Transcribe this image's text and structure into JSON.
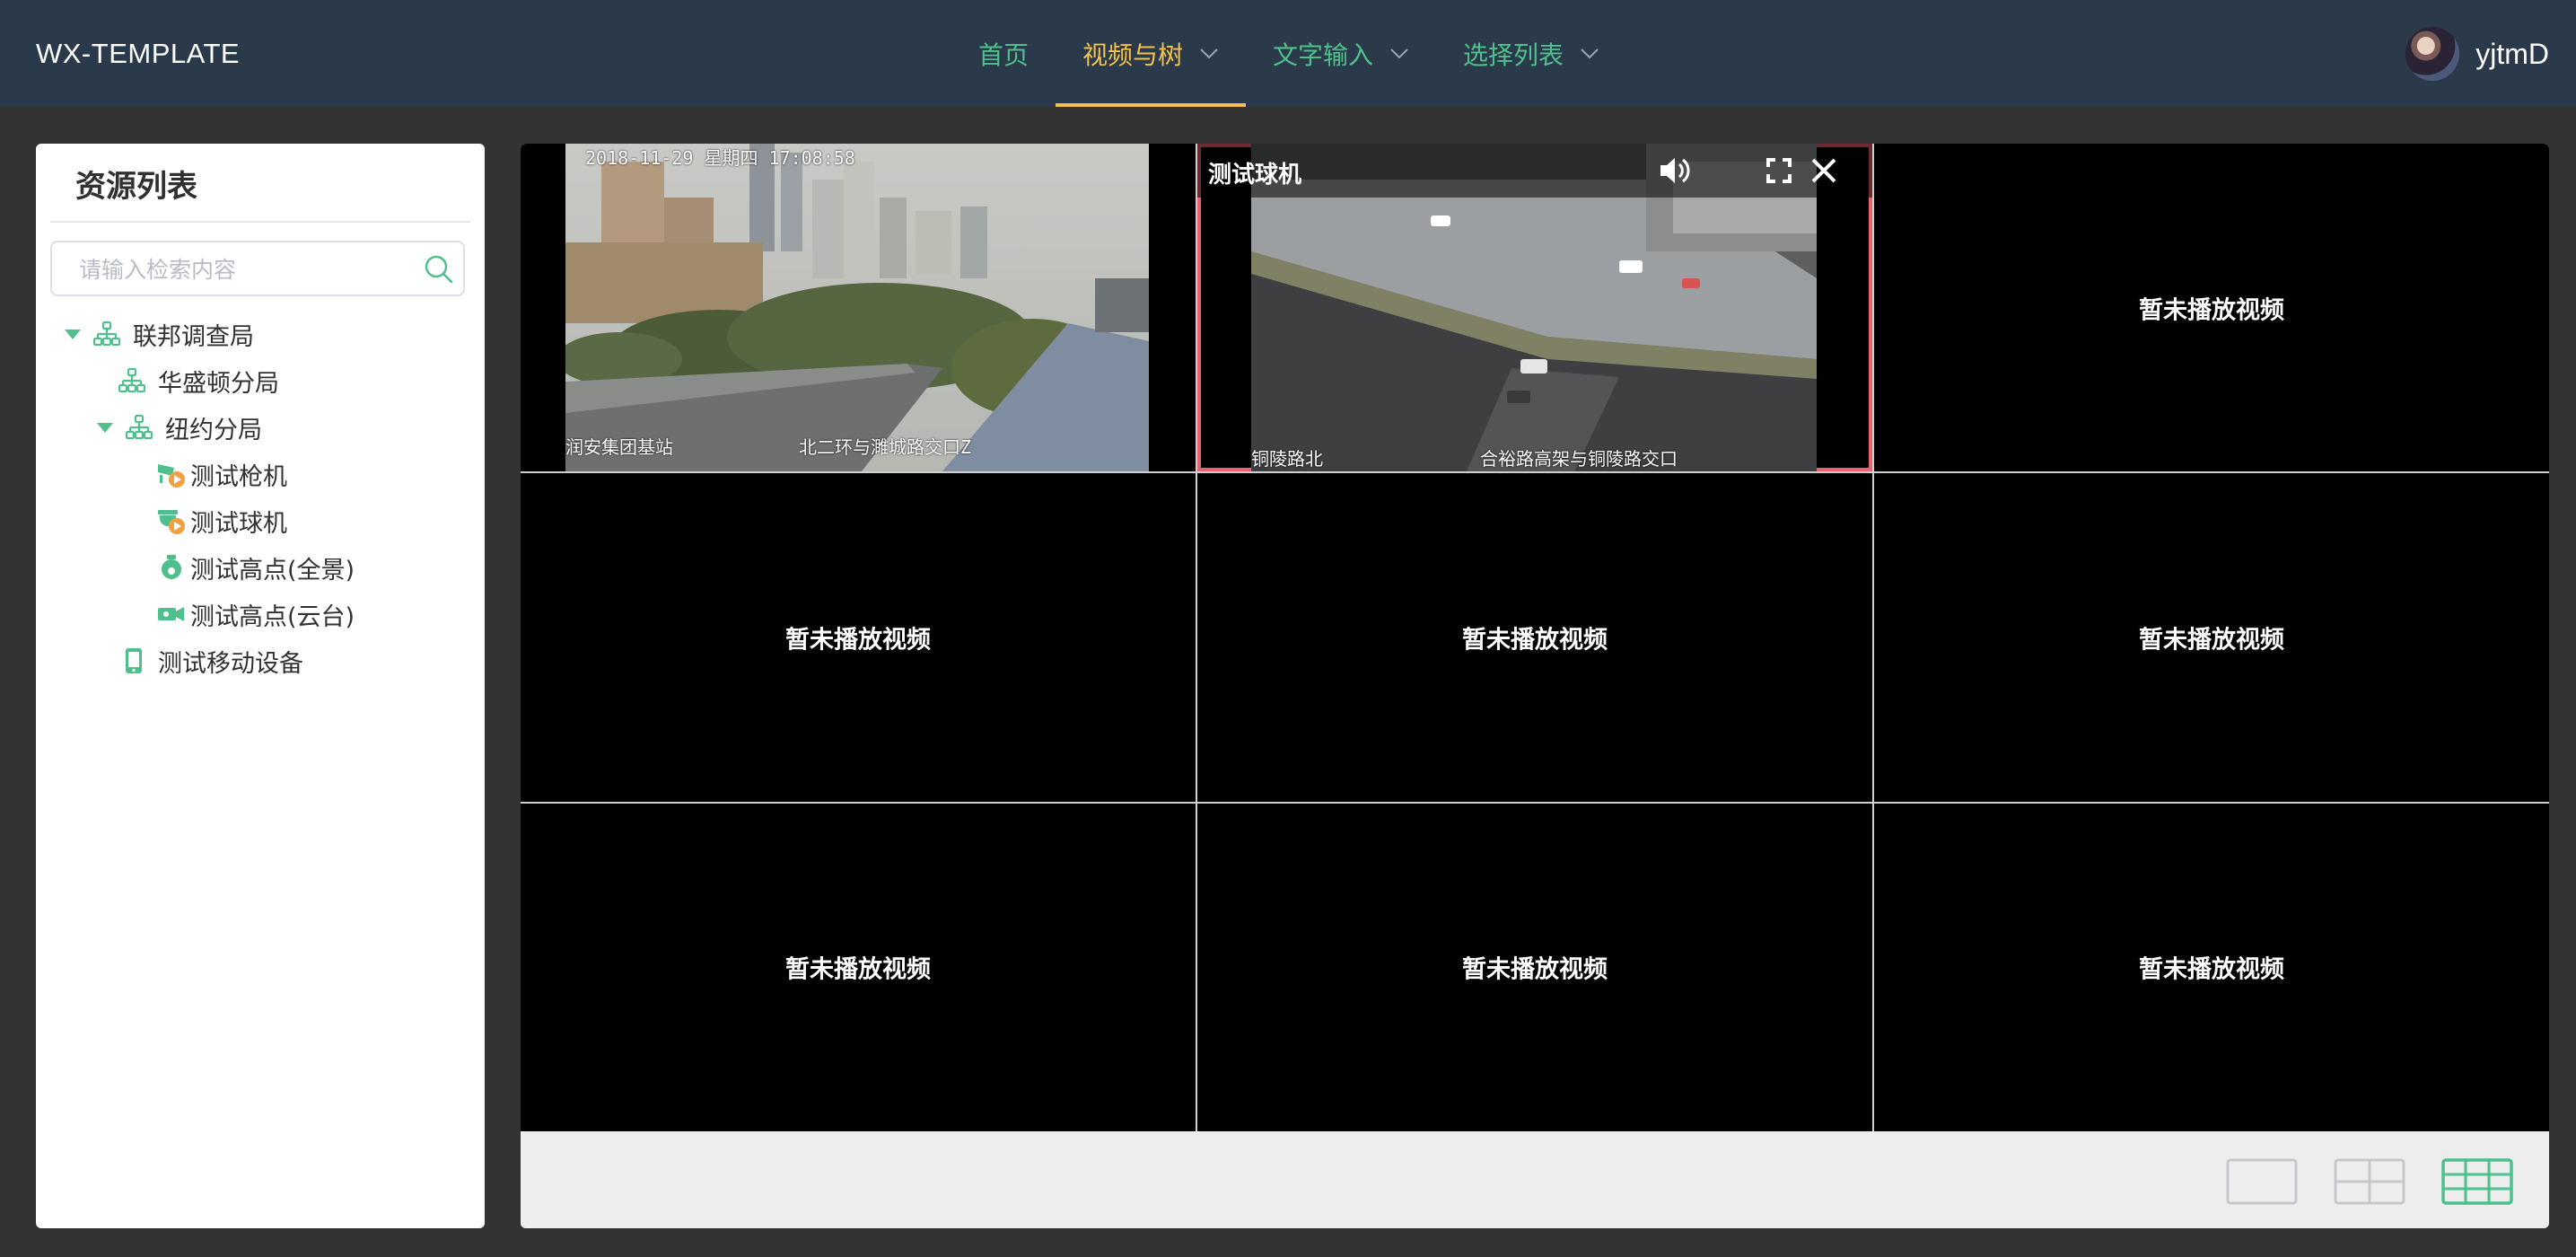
{
  "header": {
    "brand": "WX-TEMPLATE",
    "nav": [
      {
        "label": "首页",
        "dropdown": false,
        "active": false
      },
      {
        "label": "视频与树",
        "dropdown": true,
        "active": true
      },
      {
        "label": "文字输入",
        "dropdown": true,
        "active": false
      },
      {
        "label": "选择列表",
        "dropdown": true,
        "active": false
      }
    ],
    "username": "yjtmD"
  },
  "sidebar": {
    "title": "资源列表",
    "search_placeholder": "请输入检索内容",
    "tree": [
      {
        "label": "联邦调查局",
        "icon": "org-icon",
        "expanded": true
      },
      {
        "label": "华盛顿分局",
        "icon": "org-icon"
      },
      {
        "label": "纽约分局",
        "icon": "org-icon",
        "expanded": true
      },
      {
        "label": "测试枪机",
        "icon": "bullet-camera-icon"
      },
      {
        "label": "测试球机",
        "icon": "dome-camera-icon"
      },
      {
        "label": "测试高点(全景)",
        "icon": "panorama-camera-icon"
      },
      {
        "label": "测试高点(云台)",
        "icon": "ptz-camera-icon"
      },
      {
        "label": "测试移动设备",
        "icon": "mobile-device-icon"
      }
    ]
  },
  "video": {
    "empty_text": "暂未播放视频",
    "cells": [
      {
        "state": "playing",
        "feed": "city",
        "osd_time": "2018-11-29 星期四 17:08:58",
        "osd_left": "润安集团基站",
        "osd_right": "北二环与濉城路交口Z"
      },
      {
        "state": "playing",
        "feed": "road",
        "title": "测试球机",
        "selected": true,
        "osd_left": "铜陵路北",
        "osd_right": "合裕路高架与铜陵路交口"
      },
      {
        "state": "empty"
      },
      {
        "state": "empty"
      },
      {
        "state": "empty"
      },
      {
        "state": "empty"
      },
      {
        "state": "empty"
      },
      {
        "state": "empty"
      },
      {
        "state": "empty"
      }
    ],
    "layouts": [
      {
        "name": "single",
        "active": false
      },
      {
        "name": "quad",
        "active": false
      },
      {
        "name": "nine",
        "active": true
      }
    ]
  },
  "colors": {
    "header_bg": "#2b3a4a",
    "page_bg": "#333333",
    "accent_green": "#4fc08d",
    "nav_active": "#f2c14e",
    "selected_border": "#e8626f",
    "camera_badge": "#f0a040"
  }
}
